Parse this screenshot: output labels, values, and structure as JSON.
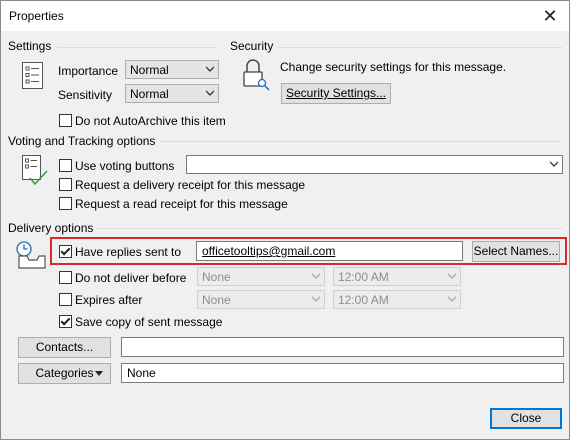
{
  "window": {
    "title": "Properties",
    "close_glyph": "✕"
  },
  "settings": {
    "heading": "Settings",
    "importance_label": "Importance",
    "importance_value": "Normal",
    "sensitivity_label": "Sensitivity",
    "sensitivity_value": "Normal",
    "autoarchive_label": "Do not AutoArchive this item",
    "autoarchive_checked": false
  },
  "security": {
    "heading": "Security",
    "description": "Change security settings for this message.",
    "button_label": "Security Settings..."
  },
  "voting": {
    "heading": "Voting and Tracking options",
    "use_voting_label": "Use voting buttons",
    "use_voting_value": "",
    "delivery_receipt_label": "Request a delivery receipt for this message",
    "read_receipt_label": "Request a read receipt for this message"
  },
  "delivery": {
    "heading": "Delivery options",
    "replies_label": "Have replies sent to",
    "replies_checked": true,
    "replies_value": "officetooltips@gmail.com",
    "select_names_label": "Select Names...",
    "do_not_deliver_label": "Do not deliver before",
    "do_not_deliver_date": "None",
    "do_not_deliver_time": "12:00 AM",
    "expires_label": "Expires after",
    "expires_date": "None",
    "expires_time": "12:00 AM",
    "save_copy_label": "Save copy of sent message",
    "save_copy_checked": true
  },
  "contacts": {
    "button_label": "Contacts...",
    "value": ""
  },
  "categories": {
    "button_label": "Categories",
    "value": "None"
  },
  "footer": {
    "close_label": "Close"
  },
  "colors": {
    "highlight": "#d9292a",
    "accent": "#0078d7"
  }
}
